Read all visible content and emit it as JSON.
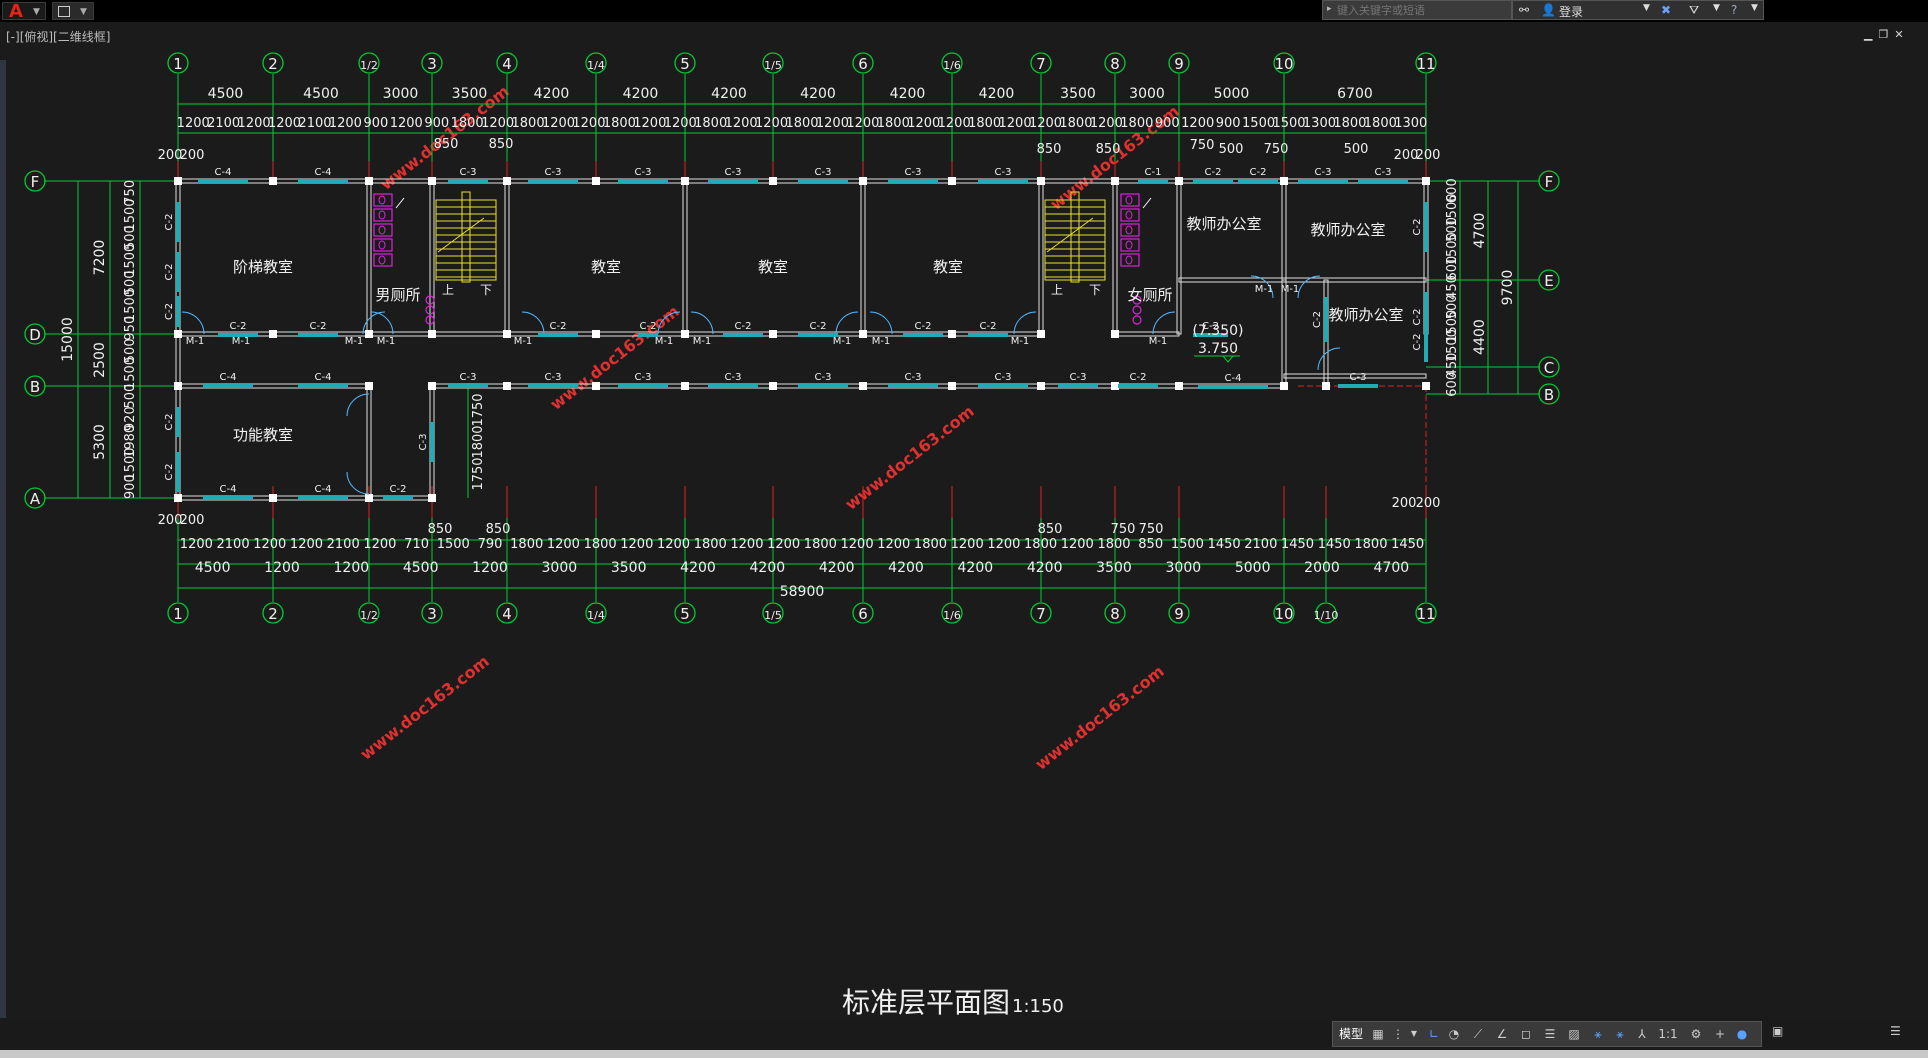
{
  "app": {
    "icon": "autocad-logo-icon",
    "viewport_label": "[-][俯视][二维线框]"
  },
  "header": {
    "search_placeholder": "键入关键字或短语",
    "login_label": "登录"
  },
  "drawing": {
    "title": "标准层平面图",
    "scale": "1:150",
    "watermark": "www.doc163.com",
    "colors": {
      "grid": "#00cc33",
      "wall": "#e0e0e0",
      "window": "#22aab5",
      "stairs": "#e8e030",
      "fixtures": "#dd22dd",
      "axis": "#e02020"
    },
    "top_axes": [
      "1",
      "2",
      "1/2",
      "3",
      "4",
      "1/4",
      "5",
      "1/5",
      "6",
      "1/6",
      "7",
      "8",
      "9",
      "10",
      "11"
    ],
    "bottom_axes": [
      "1",
      "2",
      "1/2",
      "3",
      "4",
      "1/4",
      "5",
      "1/5",
      "6",
      "1/6",
      "7",
      "8",
      "9",
      "10",
      "1/10",
      "11"
    ],
    "left_axes": [
      "F",
      "D",
      "B",
      "A"
    ],
    "right_axes": [
      "F",
      "E",
      "C",
      "B"
    ],
    "top_dims_1": [
      "4500",
      "4500",
      "3000",
      "3500",
      "4200",
      "4200",
      "4200",
      "4200",
      "4200",
      "4200",
      "3500",
      "3000",
      "5000",
      "6700"
    ],
    "top_dims_2": [
      "1200",
      "2100",
      "1200",
      "1200",
      "2100",
      "1200",
      "900",
      "1200",
      "900",
      "1800",
      "1200",
      "1800",
      "1200",
      "1200",
      "1800",
      "1200",
      "1200",
      "1800",
      "1200",
      "1200",
      "1800",
      "1200",
      "1200",
      "1800",
      "1200",
      "1200",
      "1800",
      "1200",
      "1200",
      "1800",
      "1200",
      "1800",
      "900",
      "1200",
      "900",
      "1500",
      "1500",
      "1300",
      "1800",
      "1800",
      "1300"
    ],
    "top_small_dims": [
      "200",
      "200",
      "850",
      "850",
      "850",
      "850",
      "750",
      "500",
      "750",
      "500",
      "200",
      "200"
    ],
    "bottom_dims_2": [
      "1200",
      "2100",
      "1200",
      "1200",
      "2100",
      "1200",
      "710",
      "1500",
      "790",
      "1800",
      "1200",
      "1800",
      "1200",
      "1200",
      "1800",
      "1200",
      "1200",
      "1800",
      "1200",
      "1200",
      "1800",
      "1200",
      "1200",
      "1800",
      "1200",
      "1800",
      "850",
      "1500",
      "1450",
      "2100",
      "1450",
      "1450",
      "1800",
      "1450"
    ],
    "bottom_small_dims": [
      "200",
      "200",
      "850",
      "850",
      "850",
      "750",
      "750",
      "200",
      "200"
    ],
    "bottom_dims_1": [
      "4500",
      "1200",
      "1200",
      "4500",
      "1200",
      "3000",
      "3500",
      "4200",
      "4200",
      "4200",
      "4200",
      "4200",
      "4200",
      "3500",
      "3000",
      "5000",
      "2000",
      "4700"
    ],
    "bottom_total": "58900",
    "left_dims_outer": [
      "15000"
    ],
    "left_dims_mid": [
      "7200",
      "2500",
      "5300"
    ],
    "left_dims_inner": [
      "750",
      "1500",
      "500",
      "1500",
      "500",
      "1500",
      "950",
      "500",
      "1500",
      "500",
      "920",
      "1980",
      "1500",
      "900"
    ],
    "right_dims_outer": [
      "9700"
    ],
    "right_dims_mid": [
      "4700",
      "4400"
    ],
    "right_dims_inner": [
      "600",
      "1500",
      "500",
      "1500",
      "600",
      "450",
      "500",
      "1500",
      "1500",
      "450",
      "600"
    ],
    "stair_dims": [
      "1750",
      "1800",
      "1750"
    ],
    "rooms": [
      {
        "name": "阶梯教室"
      },
      {
        "name": "男厕所"
      },
      {
        "name": "教室"
      },
      {
        "name": "教室"
      },
      {
        "name": "教室"
      },
      {
        "name": "女厕所"
      },
      {
        "name": "教师办公室"
      },
      {
        "name": "教师办公室"
      },
      {
        "name": "教师办公室"
      },
      {
        "name": "功能教室"
      }
    ],
    "stair_up": "上",
    "stair_down": "下",
    "elevation_1": "(7.350)",
    "elevation_2": "3.750",
    "labels": {
      "door": "M-1",
      "c1": "C-1",
      "c2": "C-2",
      "c3": "C-3",
      "c4": "C-4"
    }
  },
  "statusbar": {
    "model_tab": "模型",
    "ratio": "1:1"
  }
}
